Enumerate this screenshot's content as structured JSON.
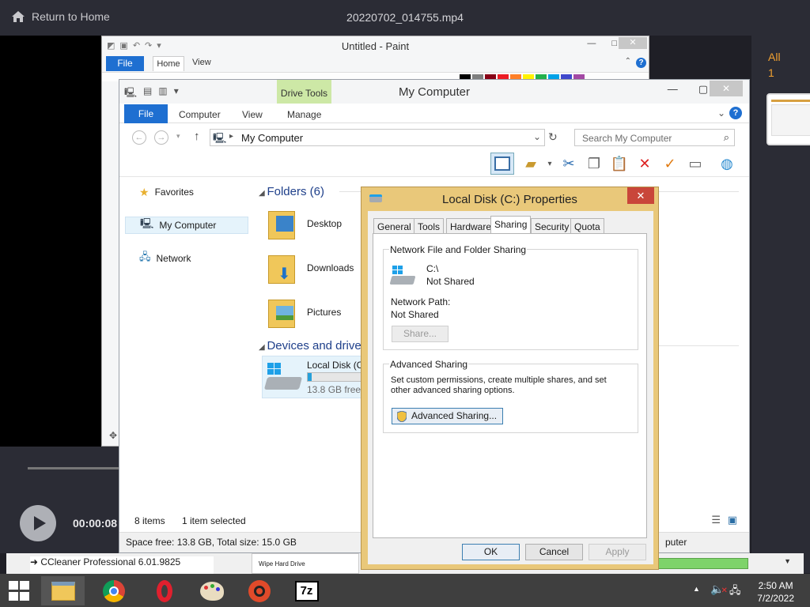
{
  "player": {
    "home_label": "Return to Home",
    "video_title": "20220702_014755.mp4",
    "all_label": "All",
    "all_count": "1",
    "time": "00:00:08"
  },
  "paint": {
    "title": "Untitled - Paint",
    "tabs": [
      "File",
      "Home",
      "View"
    ]
  },
  "explorer": {
    "title": "My Computer",
    "contextual_tab": "Drive Tools",
    "tabs": [
      "File",
      "Computer",
      "View",
      "Manage"
    ],
    "address": "My Computer",
    "search_placeholder": "Search My Computer",
    "nav": [
      "Favorites",
      "My Computer",
      "Network"
    ],
    "section_folders": "Folders (6)",
    "folders": [
      "Desktop",
      "Downloads",
      "Pictures"
    ],
    "section_devices": "Devices and drives",
    "drive_name": "Local Disk (C",
    "drive_free": "13.8 GB free o",
    "drive_used_fraction": 0.08,
    "status_items": "8 items",
    "status_selected": "1 item selected",
    "info": "Space free: 13.8 GB, Total size: 15.0 GB",
    "info_right": "puter"
  },
  "props": {
    "title": "Local Disk (C:) Properties",
    "close": "✕",
    "tabs": [
      "General",
      "Tools",
      "Hardware",
      "Sharing",
      "Security",
      "Quota"
    ],
    "nfs_group": "Network File and Folder Sharing",
    "drive": "C:\\",
    "share_state": "Not Shared",
    "path_label": "Network Path:",
    "path_value": "Not Shared",
    "share_btn": "Share...",
    "adv_group": "Advanced Sharing",
    "adv_desc": "Set custom permissions, create multiple shares, and set other advanced sharing options.",
    "adv_btn": "Advanced Sharing...",
    "ok": "OK",
    "cancel": "Cancel",
    "apply": "Apply"
  },
  "background": {
    "ccleaner": "CCleaner Professional 6.01.9825",
    "wipe": "Wipe Hard Drive"
  },
  "taskbar": {
    "time": "2:50 AM",
    "date": "7/2/2022",
    "apps": [
      "file-explorer",
      "chrome",
      "opera",
      "paint",
      "obs",
      "7zip"
    ],
    "sevenzip_label": "7z"
  }
}
